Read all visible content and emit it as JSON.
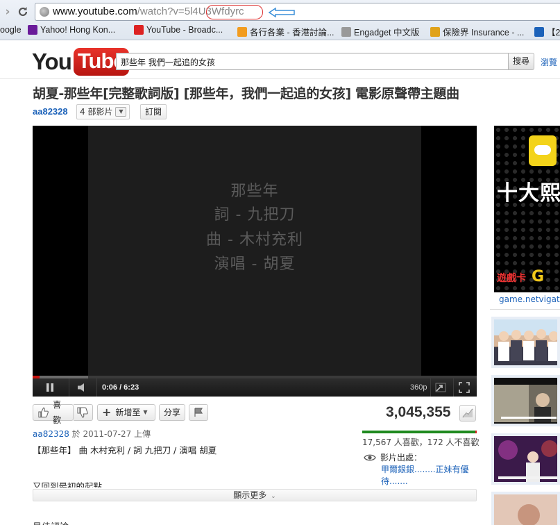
{
  "browser": {
    "url_host": "www.youtube.com",
    "url_path": "/watch?v=",
    "url_video_id": "5l4U3Wfdyrc",
    "bookmarks": [
      {
        "label": "oogle",
        "icon": "google-icon",
        "color": "#4285f4"
      },
      {
        "label": "Yahoo! Hong Kon...",
        "icon": "yahoo-icon",
        "color": "#6a1b9a"
      },
      {
        "label": "YouTube - Broadc...",
        "icon": "youtube-icon",
        "color": "#d22"
      },
      {
        "label": "各行各業 - 香港討論...",
        "icon": "chat-bubble-icon",
        "color": "#f29c1f"
      },
      {
        "label": "Engadget 中文版",
        "icon": "rss-icon",
        "color": "#999"
      },
      {
        "label": "保險界 Insurance - ...",
        "icon": "u-logo-icon",
        "color": "#e0a21a"
      },
      {
        "label": "【2",
        "icon": "bookmark-icon",
        "color": "#1c62b9"
      }
    ]
  },
  "youtube": {
    "logo_you": "You",
    "logo_tube": "Tube",
    "search_value": "那些年 我們一起追的女孩",
    "search_button": "搜尋",
    "browse_link": "瀏覽"
  },
  "video": {
    "title": "胡夏-那些年[完整歌詞版] [那些年，我們一起追的女孩] 電影原聲帶主題曲",
    "channel": "aa82328",
    "video_count": "4 部影片",
    "subscribe": "訂閱",
    "lyrics": [
      "那些年",
      "詞 - 九把刀",
      "曲 - 木村充利",
      "演唱 - 胡夏"
    ],
    "time": "0:06 / 6:23",
    "quality": "360p",
    "progress_played": 0.016,
    "progress_buffered": 0.125
  },
  "actions": {
    "like": "喜歡",
    "add_to": "新增至",
    "share": "分享",
    "views": "3,045,355",
    "likes_summary": "17,567 人喜歡，172 人不喜歡",
    "like_ratio": 0.99,
    "featured_label": "影片出處：",
    "featured_link": "甲爾銀銀........正妹有優待......."
  },
  "details": {
    "uploader": "aa82328",
    "uploaded_on": " 於 2011-07-27 上傳",
    "description": "【那些年】 曲 木村充利 / 詞 九把刀 / 演唱 胡夏",
    "description_line2": "又回到最初的起點",
    "show_more": "顯示更多",
    "comments_label": "最佳評論"
  },
  "sidebar": {
    "ad_text": "十大熙",
    "ad_logo": "遊戲卡",
    "ad_logo_g": "G",
    "ad_url": "game.netvigator"
  }
}
